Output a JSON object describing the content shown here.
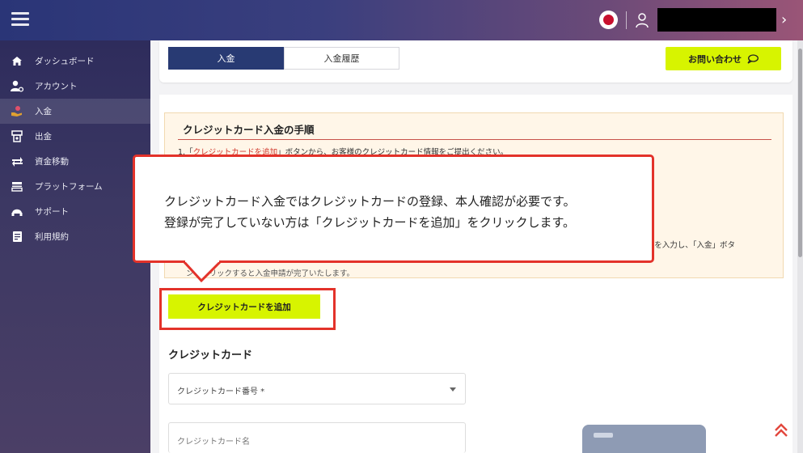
{
  "header": {
    "user_name_redacted": "",
    "chevron": "›"
  },
  "sidebar": {
    "items": [
      {
        "label": "ダッシュボード",
        "icon": "home-icon"
      },
      {
        "label": "アカウント",
        "icon": "account-settings-icon"
      },
      {
        "label": "入金",
        "icon": "deposit-icon"
      },
      {
        "label": "出金",
        "icon": "withdraw-icon"
      },
      {
        "label": "資金移動",
        "icon": "transfer-icon"
      },
      {
        "label": "プラットフォーム",
        "icon": "platform-icon"
      },
      {
        "label": "サポート",
        "icon": "support-icon"
      },
      {
        "label": "利用規約",
        "icon": "terms-icon"
      }
    ],
    "active_index": 2
  },
  "tabs": {
    "deposit": "入金",
    "history": "入金履歴"
  },
  "contact_button": "お問い合わせ",
  "steps": {
    "title": "クレジットカード入金の手順",
    "step1_prefix": "1.「",
    "step1_link": "クレジットカードを追加",
    "step1_suffix": "」ボタンから、お客様のクレジットカード情報をご提出ください。",
    "partial_a": "ド)を入力し、「入金」ボタ",
    "partial_b": "ンをクリックすると入金申請が完了いたします。"
  },
  "add_card_button": "クレジットカードを追加",
  "credit_card_section": {
    "heading": "クレジットカード",
    "number_label": "クレジットカード番号 *",
    "name_placeholder": "クレジットカード名"
  },
  "callout": {
    "line1": "クレジットカード入金ではクレジットカードの登録、本人確認が必要です。",
    "line2": "登録が完了していない方は「クレジットカードを追加」をクリックします。"
  },
  "colors": {
    "accent_lime": "#d7f400",
    "tab_active": "#283a73",
    "highlight_red": "#e3322a"
  }
}
